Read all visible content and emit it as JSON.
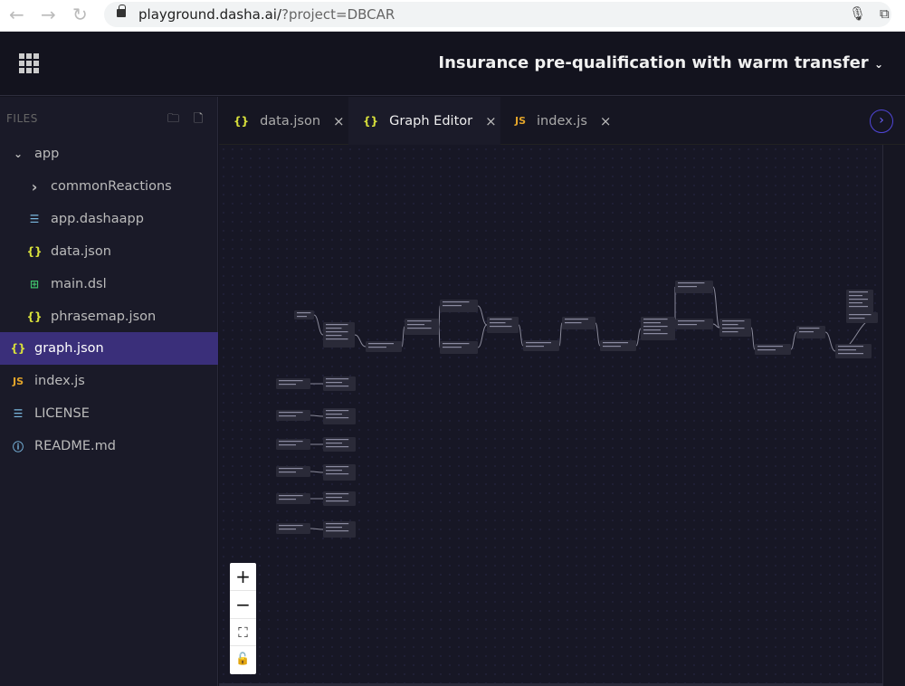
{
  "browser": {
    "url_host": "playground.dasha.ai/",
    "url_query": "?project=DBCAR"
  },
  "header": {
    "title": "Insurance pre-qualification with warm transfer",
    "title_chevron": "⌄"
  },
  "sidebar": {
    "label": "FILES",
    "items": [
      {
        "label": "app",
        "icon": "chevron-down-icon",
        "glyph": "⌄"
      },
      {
        "label": "commonReactions",
        "icon": "chevron-right-icon",
        "glyph": "›"
      },
      {
        "label": "app.dashaapp",
        "icon": "lines-icon",
        "glyph": "☰"
      },
      {
        "label": "data.json",
        "icon": "braces-icon",
        "glyph": "{}"
      },
      {
        "label": "main.dsl",
        "icon": "dsl-icon",
        "glyph": "⊞"
      },
      {
        "label": "phrasemap.json",
        "icon": "braces-icon",
        "glyph": "{}"
      },
      {
        "label": "graph.json",
        "icon": "braces-icon",
        "glyph": "{}"
      },
      {
        "label": "index.js",
        "icon": "js-icon",
        "glyph": "JS"
      },
      {
        "label": "LICENSE",
        "icon": "lines-icon",
        "glyph": "☰"
      },
      {
        "label": "README.md",
        "icon": "info-icon",
        "glyph": "ⓘ"
      }
    ]
  },
  "tabs": [
    {
      "label": "data.json",
      "icon": "{}",
      "close": "×"
    },
    {
      "label": "Graph Editor",
      "icon": "{}",
      "close": "×"
    },
    {
      "label": "index.js",
      "icon": "JS",
      "close": "×"
    }
  ],
  "zoom_controls": {
    "zoom_in": "+",
    "zoom_out": "−",
    "fit": "⛶",
    "lock": "🔓"
  },
  "colors": {
    "accent": "#3a2f7a",
    "json_icon": "#d8e03b",
    "js_icon": "#e3a52a",
    "next_button": "#5046d8"
  }
}
